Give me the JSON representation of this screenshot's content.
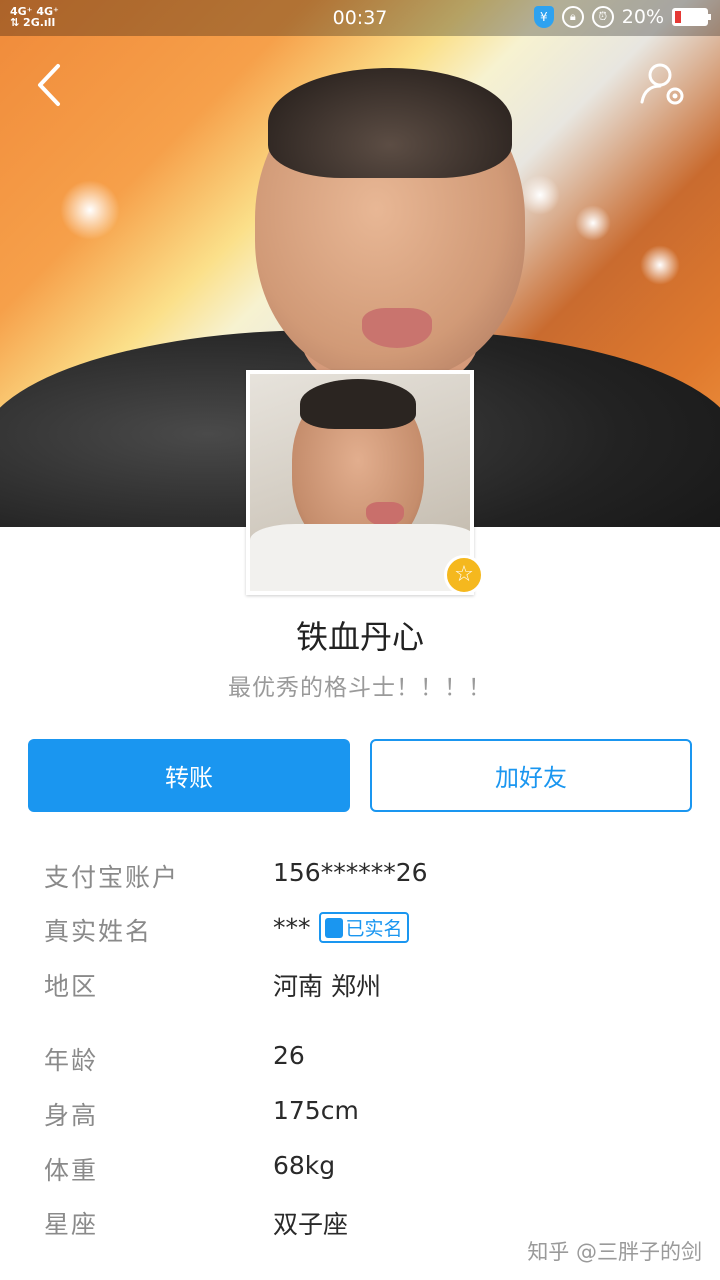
{
  "status_bar": {
    "network": "4G⁺ 4G⁺\n2G",
    "time": "00:37",
    "alipay_icon": "¥",
    "battery": "20%",
    "battery_level": 0.2
  },
  "icons": {
    "back": "chevron-left-icon",
    "settings": "profile-settings-icon",
    "star": "star-icon",
    "verified": "id-card-icon"
  },
  "profile": {
    "nickname": "铁血丹心",
    "signature": "最优秀的格斗士！！！！"
  },
  "actions": {
    "transfer": "转账",
    "add_friend": "加好友"
  },
  "info": [
    {
      "label": "支付宝账户",
      "value": "156******26"
    },
    {
      "label": "真实姓名",
      "value": "***",
      "badge": "已实名"
    },
    {
      "label": "地区",
      "value": "河南 郑州"
    },
    {
      "label": "年龄",
      "value": "26"
    },
    {
      "label": "身高",
      "value": "175cm"
    },
    {
      "label": "体重",
      "value": "68kg"
    },
    {
      "label": "星座",
      "value": "双子座"
    }
  ],
  "watermark": "知乎 @三胖子的剑",
  "colors": {
    "accent": "#1a96f0",
    "badge": "#f5b81e"
  }
}
